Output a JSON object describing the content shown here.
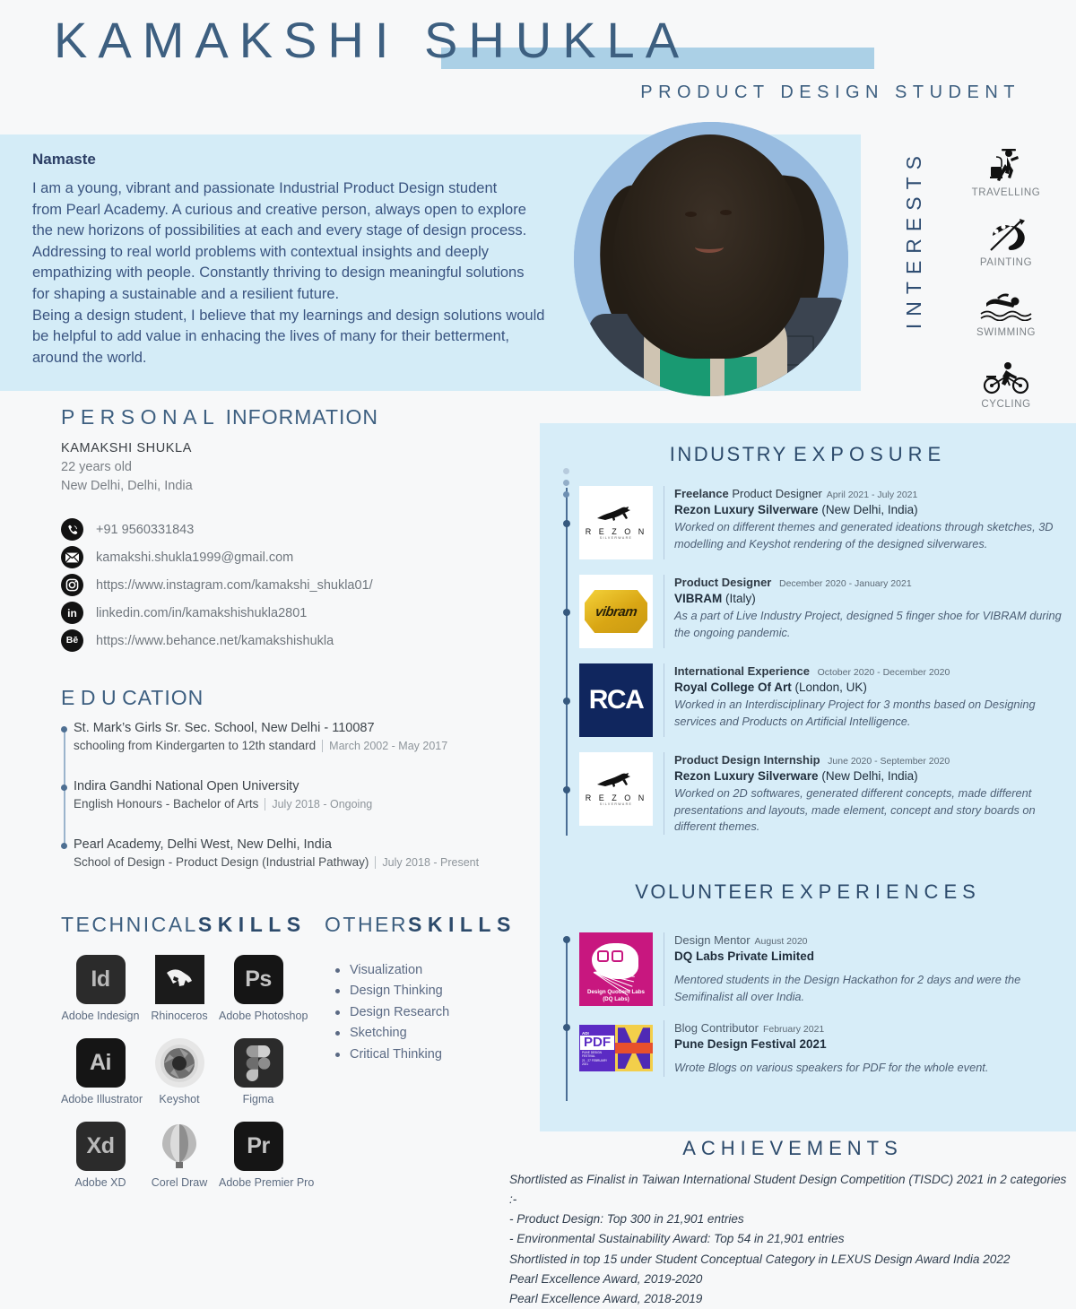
{
  "header": {
    "name": "KAMAKSHI SHUKLA",
    "subtitle": "PRODUCT DESIGN STUDENT",
    "accent_color": "#abd0e6",
    "title_color": "#3d5f80"
  },
  "hero": {
    "greeting": "Namaste",
    "bio_lines": [
      "I am a young, vibrant and passionate Industrial Product Design student",
      "from Pearl Academy. A curious and creative person, always open to explore",
      "the new horizons of possibilities at each and every stage of design process.",
      "Addressing to real world problems with contextual insights and deeply",
      "empathizing with people. Constantly thriving to design meaningful solutions",
      "for shaping a sustainable and a resilient future.",
      "Being a design student, I believe that my learnings and design solutions would",
      "be helpful to add value in enhacing the lives of many for their betterment,",
      "around the world."
    ],
    "band_color": "#d4ecf7",
    "photo_alt": "portrait-photo"
  },
  "interests": {
    "label": "INTERESTS",
    "items": [
      {
        "icon": "travelling-icon",
        "label": "TRAVELLING"
      },
      {
        "icon": "painting-icon",
        "label": "PAINTING"
      },
      {
        "icon": "swimming-icon",
        "label": "SWIMMING"
      },
      {
        "icon": "cycling-icon",
        "label": "CYCLING"
      }
    ]
  },
  "personal_information": {
    "heading_bold": "PERSONAL",
    "heading_light": "INFORMATION",
    "name": "KAMAKSHI  SHUKLA",
    "age": "22 years old",
    "location": "New Delhi, Delhi, India",
    "contacts": [
      {
        "icon": "phone-icon",
        "glyph": "✆",
        "text": "+91 9560331843"
      },
      {
        "icon": "email-icon",
        "glyph": "✉",
        "text": "kamakshi.shukla1999@gmail.com"
      },
      {
        "icon": "instagram-icon",
        "glyph": "◎",
        "text": "https://www.instagram.com/kamakshi_shukla01/"
      },
      {
        "icon": "linkedin-icon",
        "glyph": "in",
        "text": "linkedin.com/in/kamakshishukla2801"
      },
      {
        "icon": "behance-icon",
        "glyph": "Bē",
        "text": "https://www.behance.net/kamakshishukla"
      }
    ]
  },
  "education": {
    "heading_bold": "EDU",
    "heading_light": "CATION",
    "items": [
      {
        "title": "St. Mark’s Girls Sr. Sec. School, New Delhi - 110087",
        "sub": "schooling from Kindergarten to 12th standard",
        "date": "March 2002 - May 2017"
      },
      {
        "title": "Indira Gandhi National Open University",
        "sub": "English Honours - Bachelor of Arts",
        "date": "July 2018 - Ongoing"
      },
      {
        "title": "Pearl Academy, Delhi West, New Delhi, India",
        "sub": "School of Design - Product Design (Industrial Pathway)",
        "date": "July 2018 - Present"
      }
    ]
  },
  "technical_skills": {
    "heading_light": "TECHNICAL",
    "heading_bold": "SKILLS",
    "items": [
      {
        "icon": "adobe-indesign-icon",
        "glyph": "Id",
        "name": "Adobe Indesign",
        "style": "adobe"
      },
      {
        "icon": "rhinoceros-icon",
        "glyph": "",
        "name": "Rhinoceros",
        "style": "rhino"
      },
      {
        "icon": "adobe-photoshop-icon",
        "glyph": "Ps",
        "name": "Adobe Photoshop",
        "style": "adobe-dark"
      },
      {
        "icon": "adobe-illustrator-icon",
        "glyph": "Ai",
        "name": "Adobe Illustrator",
        "style": "adobe-dark"
      },
      {
        "icon": "keyshot-icon",
        "glyph": "",
        "name": "Keyshot",
        "style": "keyshot"
      },
      {
        "icon": "figma-icon",
        "glyph": "",
        "name": "Figma",
        "style": "figma"
      },
      {
        "icon": "adobe-xd-icon",
        "glyph": "Xd",
        "name": "Adobe XD",
        "style": "adobe"
      },
      {
        "icon": "corel-draw-icon",
        "glyph": "",
        "name": "Corel Draw",
        "style": "corel"
      },
      {
        "icon": "adobe-premiere-icon",
        "glyph": "Pr",
        "name": "Adobe Premier Pro",
        "style": "adobe-dark"
      }
    ]
  },
  "other_skills": {
    "heading_light": "OTHER",
    "heading_bold": "SKILLS",
    "items": [
      "Visualization",
      "Design Thinking",
      "Design Research",
      "Sketching",
      "Critical Thinking"
    ]
  },
  "industry_exposure": {
    "heading_bold": "INDUSTRY",
    "heading_light": "EXPOSURE",
    "items": [
      {
        "logo": "rezon-logo",
        "role_bold": "Freelance",
        "role_light": "Product Designer",
        "date": "April 2021 - July 2021",
        "org_bold": "Rezon Luxury Silverware",
        "org_light": "(New Delhi, India)",
        "desc": "Worked on different themes and generated ideations through sketches, 3D modelling and Keyshot rendering of the designed silverwares."
      },
      {
        "logo": "vibram-logo",
        "role_bold": "Product Designer",
        "role_light": "",
        "date": "December 2020 - January 2021",
        "org_bold": "VIBRAM",
        "org_light": "(Italy)",
        "desc": "As a part of Live Industry Project, designed 5 finger shoe for VIBRAM during the ongoing pandemic."
      },
      {
        "logo": "rca-logo",
        "role_bold": "International Experience",
        "role_light": "",
        "date": "October 2020 - December 2020",
        "org_bold": "Royal College Of Art",
        "org_light": "(London, UK)",
        "desc": "Worked in an Interdisciplinary Project for 3 months based on Designing services and Products on Artificial Intelligence."
      },
      {
        "logo": "rezon-logo",
        "role_bold": "Product Design Internship",
        "role_light": "",
        "date": "June 2020 - September 2020",
        "org_bold": "Rezon Luxury Silverware",
        "org_light": "(New Delhi, India)",
        "desc": "Worked on 2D softwares, generated different concepts, made different presentations and layouts, made element, concept and story boards on different themes."
      }
    ]
  },
  "volunteer_experiences": {
    "heading_bold": "VOLUNTEER",
    "heading_light": "EXPERIENCES",
    "items": [
      {
        "logo": "dq-labs-logo",
        "role_light": "Design Mentor",
        "date": "August 2020",
        "org_bold": "DQ Labs Private Limited",
        "desc": "Mentored students in the Design Hackathon for 2 days and were the Semifinalist all over India."
      },
      {
        "logo": "pdf-logo",
        "role_light": "Blog Contributor",
        "date": "February 2021",
        "org_bold": "Pune Design Festival 2021",
        "desc": "Wrote Blogs on various speakers for PDF for the whole event."
      }
    ]
  },
  "achievements": {
    "heading": "ACHIEVEMENTS",
    "items": [
      "Shortlisted as Finalist in Taiwan International Student Design Competition (TISDC) 2021 in 2 categories :-",
      "- Product Design: Top 300 in 21,901 entries",
      "- Environmental Sustainability Award: Top 54 in 21,901 entries",
      "Shortlisted in top 15 under Student Conceptual Category in LEXUS Design Award India 2022",
      "Pearl Excellence Award, 2019-2020",
      "Pearl Excellence Award, 2018-2019"
    ]
  },
  "logos": {
    "rezon_word": "R E Z O N",
    "rezon_tag": "SILVERWARE",
    "vibram_word": "vibram",
    "rca_word": "RCA",
    "dq_caption_1": "Design Quotient Labs",
    "dq_caption_2": "(DQ Labs)",
    "pdf_word": "PDF",
    "pdf_adi": "ADI",
    "pdf_sub": "PUNE DESIGN FESTIVAL",
    "pdf_date": "21 - 27 FEBRUARY 2021"
  }
}
